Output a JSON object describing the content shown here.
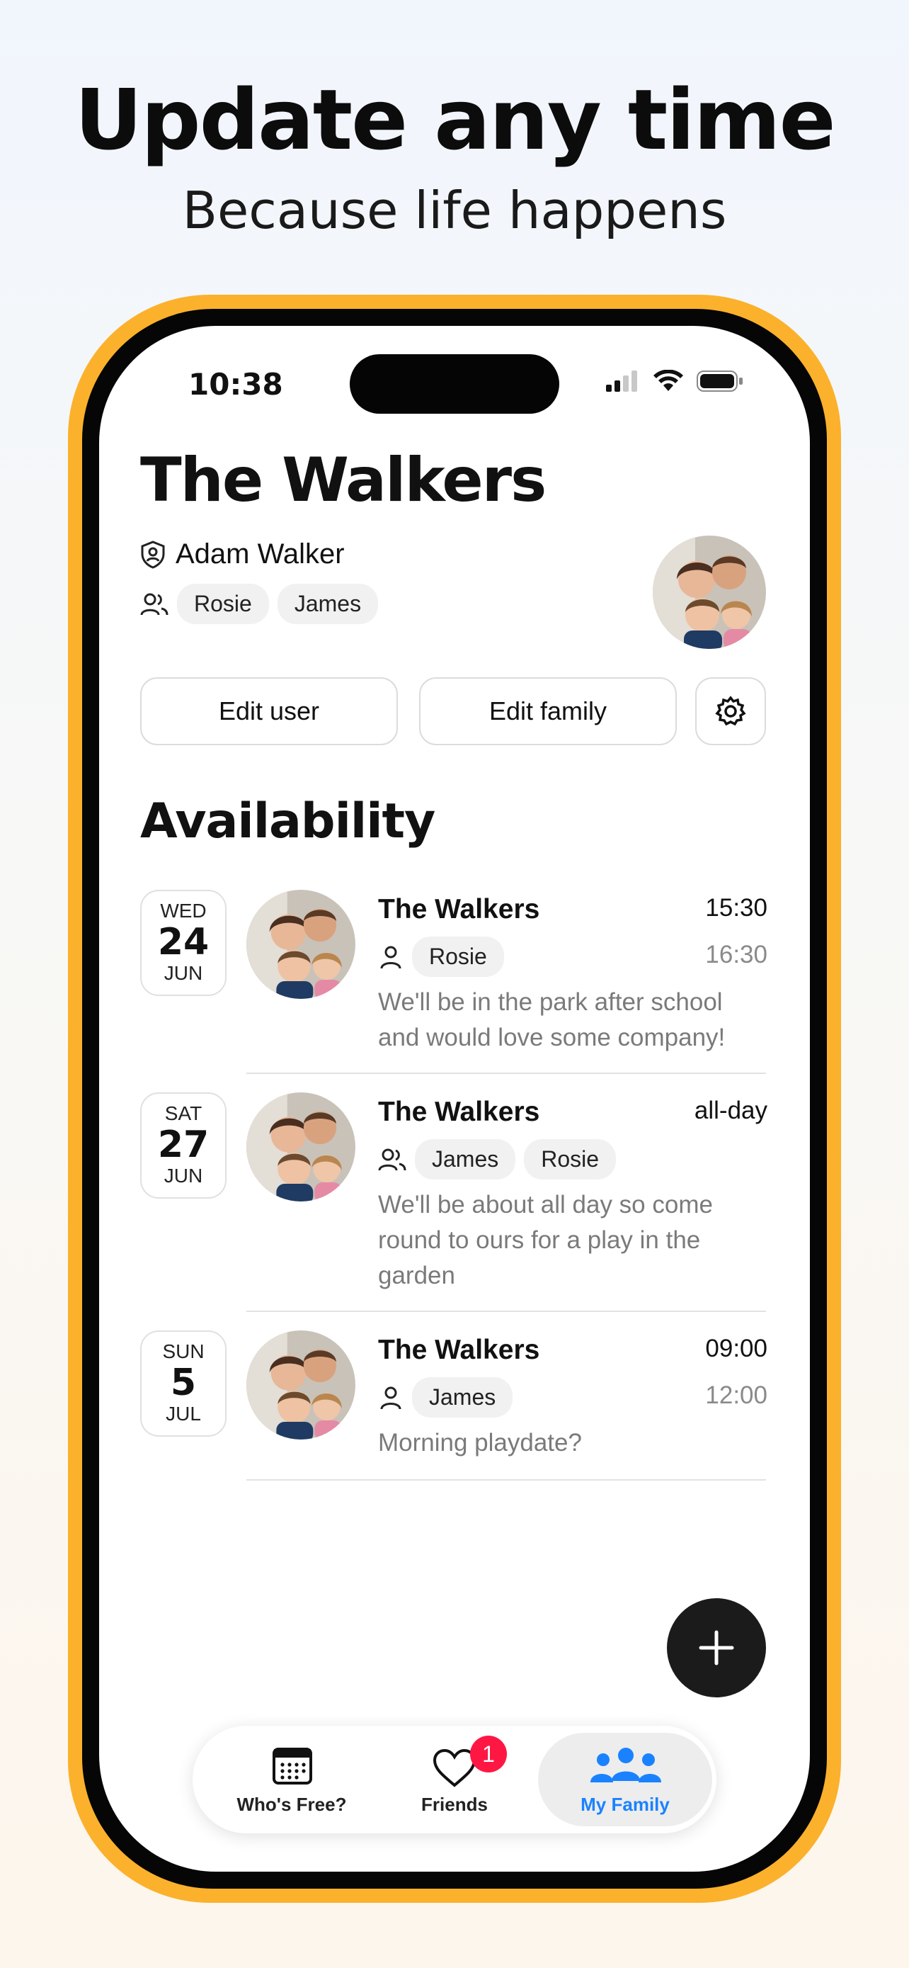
{
  "marketing": {
    "headline": "Update any time",
    "subheadline": "Because life happens"
  },
  "status_bar": {
    "time": "10:38"
  },
  "family": {
    "name": "The Walkers",
    "admin": "Adam Walker",
    "members": [
      "Rosie",
      "James"
    ]
  },
  "actions": {
    "edit_user": "Edit user",
    "edit_family": "Edit family"
  },
  "availability": {
    "title": "Availability",
    "events": [
      {
        "dow": "WED",
        "day": "24",
        "month": "JUN",
        "family": "The Walkers",
        "start": "15:30",
        "end": "16:30",
        "people": [
          "Rosie"
        ],
        "note": "We'll be in the park after school and would love some company!"
      },
      {
        "dow": "SAT",
        "day": "27",
        "month": "JUN",
        "family": "The Walkers",
        "start": "all-day",
        "end": "",
        "people": [
          "James",
          "Rosie"
        ],
        "note": "We'll be about all day so come round to ours for a play in the garden"
      },
      {
        "dow": "SUN",
        "day": "5",
        "month": "JUL",
        "family": "The Walkers",
        "start": "09:00",
        "end": "12:00",
        "people": [
          "James"
        ],
        "note": "Morning playdate?"
      }
    ]
  },
  "tabbar": {
    "tabs": [
      {
        "label": "Who's Free?",
        "icon": "calendar-icon",
        "active": false
      },
      {
        "label": "Friends",
        "icon": "heart-icon",
        "active": false,
        "badge": "1"
      },
      {
        "label": "My Family",
        "icon": "family-icon",
        "active": true
      }
    ]
  },
  "colors": {
    "frame": "#fbb12b",
    "accent": "#1a82ff",
    "badge": "#ff1744",
    "fab": "#1b1b1b"
  }
}
